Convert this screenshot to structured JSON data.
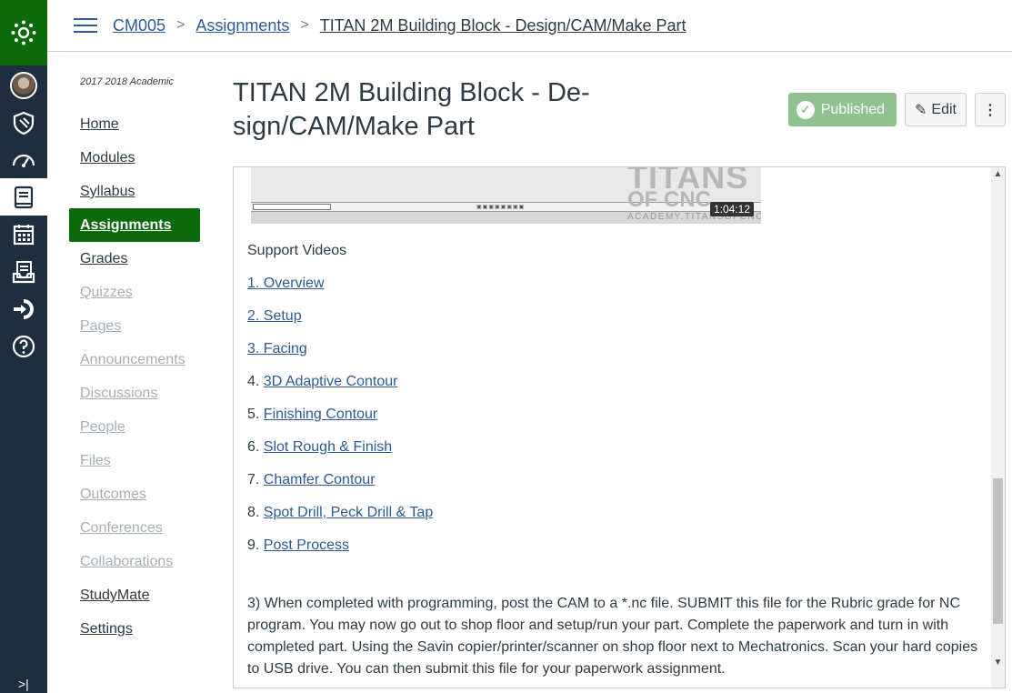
{
  "global_nav": {
    "items": [
      {
        "icon": "account-avatar"
      },
      {
        "icon": "admin-shield-icon"
      },
      {
        "icon": "dashboard-icon"
      },
      {
        "icon": "courses-icon",
        "active": true
      },
      {
        "icon": "calendar-icon"
      },
      {
        "icon": "inbox-icon"
      },
      {
        "icon": "commons-icon"
      },
      {
        "icon": "help-icon"
      }
    ],
    "brand_color": "#0b6b0b",
    "background": "#1d2f3f"
  },
  "breadcrumb": {
    "course": "CM005",
    "section": "Assignments",
    "current": "TITAN 2M Building Block - Design/CAM/Make Part"
  },
  "course_nav": {
    "term": "2017 2018 Academic",
    "items": [
      {
        "label": "Home",
        "state": "normal"
      },
      {
        "label": "Modules",
        "state": "normal"
      },
      {
        "label": "Syllabus",
        "state": "normal"
      },
      {
        "label": "Assignments",
        "state": "active"
      },
      {
        "label": "Grades",
        "state": "normal"
      },
      {
        "label": "Quizzes",
        "state": "disabled"
      },
      {
        "label": "Pages",
        "state": "disabled"
      },
      {
        "label": "Announcements",
        "state": "disabled"
      },
      {
        "label": "Discussions",
        "state": "disabled"
      },
      {
        "label": "People",
        "state": "disabled"
      },
      {
        "label": "Files",
        "state": "disabled"
      },
      {
        "label": "Outcomes",
        "state": "disabled"
      },
      {
        "label": "Conferences",
        "state": "disabled"
      },
      {
        "label": "Collaborations",
        "state": "disabled"
      },
      {
        "label": "StudyMate",
        "state": "normal"
      },
      {
        "label": "Settings",
        "state": "normal"
      }
    ]
  },
  "assignment": {
    "title": "TITAN 2M Building Block - De-sign/CAM/Make Part",
    "published_label": "Published",
    "edit_label": "Edit",
    "more_label": "⋮"
  },
  "video": {
    "duration": "1:04:12",
    "watermark_line1": "TITANS",
    "watermark_line2": "OF CNC",
    "watermark_line3": "ACADEMY.TITANSOFCNC.COM"
  },
  "content": {
    "heading": "Support Videos",
    "videos": [
      {
        "prefix": "",
        "label": "1. Overview"
      },
      {
        "prefix": "",
        "label": "2. Setup"
      },
      {
        "prefix": "",
        "label": "3. Facing"
      },
      {
        "prefix": "4. ",
        "label": "3D Adaptive Contour"
      },
      {
        "prefix": "5. ",
        "label": "Finishing Contour "
      },
      {
        "prefix": "6. ",
        "label": "Slot Rough & Finish"
      },
      {
        "prefix": "7. ",
        "label": "Chamfer Contour"
      },
      {
        "prefix": "8. ",
        "label": "Spot Drill, Peck Drill & Tap"
      },
      {
        "prefix": "9. ",
        "label": "Post Process"
      }
    ],
    "paragraph": "3) When completed with programming, post the CAM to a *.nc file.   SUBMIT this file for the Rubric grade for NC program.  You may now go out to shop floor and setup/run your part.  Complete the paperwork and turn in with completed part.  Using the Savin copier/printer/scanner on shop floor next to Mechatronics. Scan your hard copies to USB drive.  You can then submit this file for your paperwork assignment."
  }
}
